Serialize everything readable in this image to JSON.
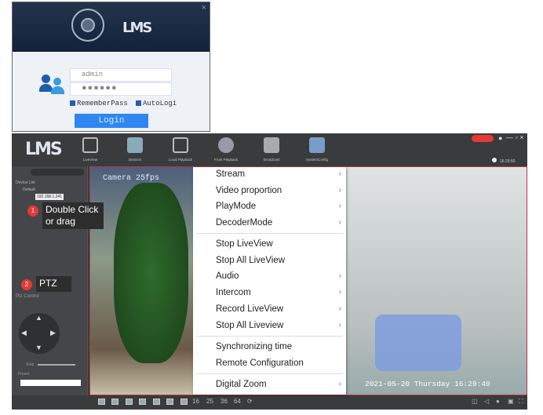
{
  "login": {
    "logo": "LMS",
    "close": "×",
    "username": "admin",
    "password": "●●●●●●",
    "remember_pass": "RememberPass",
    "auto_login": "AutoLogi",
    "login_button": "Login"
  },
  "app": {
    "logo": "LMS",
    "toolbar": [
      {
        "label": "LiveView"
      },
      {
        "label": "Devices"
      },
      {
        "label": "Local Playback"
      },
      {
        "label": "Front Playback"
      },
      {
        "label": "Broadcast"
      },
      {
        "label": "SystemConfig"
      }
    ],
    "clock": "16:29:50",
    "window_controls": {
      "minimize": "—",
      "restore": "▫",
      "close": "×"
    },
    "device_tree": {
      "root": "Device List",
      "group": "Default",
      "device": "192.168.1.241"
    },
    "ptz": {
      "title": "Ptz Control",
      "step_label": "Step",
      "preset_label": "Preset"
    },
    "video": {
      "osd_title": "Camera 25fps",
      "timestamp": "2021-05-20 Thursday 16:29:49"
    },
    "bottom_bar": {
      "layouts": [
        "16",
        "25",
        "36",
        "64"
      ]
    }
  },
  "annotations": {
    "n1": "1",
    "callout1": "Double Click or drag",
    "n2": "2",
    "callout2": "PTZ"
  },
  "context_menu": [
    {
      "label": "Stream",
      "submenu": true
    },
    {
      "label": "Video proportion",
      "submenu": true
    },
    {
      "label": "PlayMode",
      "submenu": true
    },
    {
      "label": "DecoderMode",
      "submenu": true
    },
    {
      "label": "Stop LiveView",
      "submenu": false
    },
    {
      "label": "Stop All LiveView",
      "submenu": false
    },
    {
      "label": "Audio",
      "submenu": true
    },
    {
      "label": "Intercom",
      "submenu": true
    },
    {
      "label": "Record LiveView",
      "submenu": true
    },
    {
      "label": "Stop All Liveview",
      "submenu": true
    },
    {
      "label": "Synchronizing time",
      "submenu": false
    },
    {
      "label": "Remote Configuration",
      "submenu": false
    },
    {
      "label": "Digital Zoom",
      "submenu": true
    }
  ],
  "arrow": "›"
}
